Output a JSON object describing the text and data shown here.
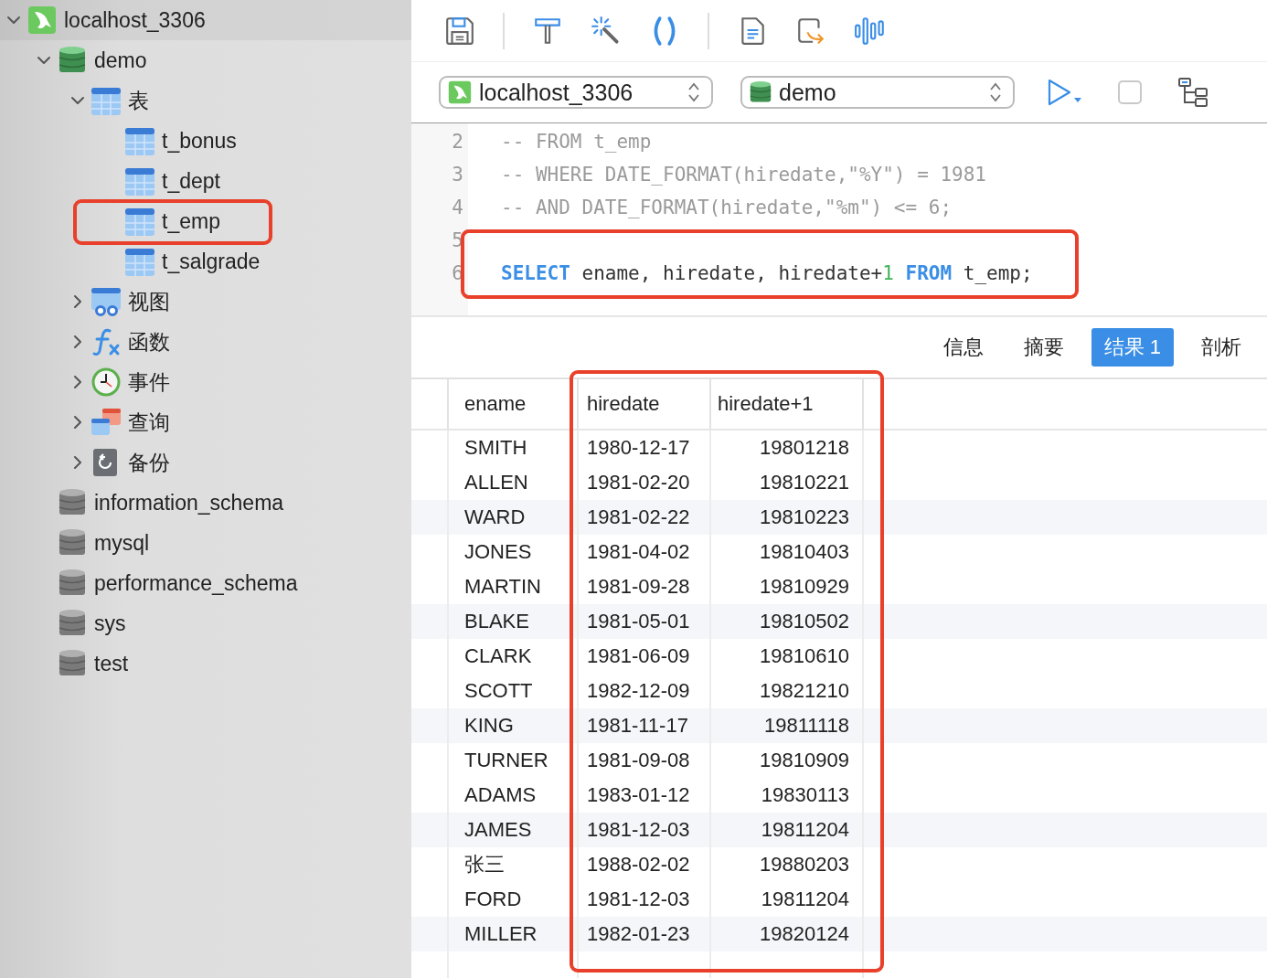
{
  "tree": [
    {
      "label": "localhost_3306",
      "kind": "server",
      "expanded": true,
      "children": [
        {
          "label": "demo",
          "kind": "db-open",
          "expanded": true,
          "children": [
            {
              "label": "表",
              "kind": "tables",
              "expanded": true,
              "children": [
                {
                  "label": "t_bonus",
                  "kind": "table",
                  "highlighted": false
                },
                {
                  "label": "t_dept",
                  "kind": "table",
                  "highlighted": false
                },
                {
                  "label": "t_emp",
                  "kind": "table",
                  "highlighted": true
                },
                {
                  "label": "t_salgrade",
                  "kind": "table",
                  "highlighted": false
                }
              ]
            },
            {
              "label": "视图",
              "kind": "views",
              "expanded": false
            },
            {
              "label": "函数",
              "kind": "functions",
              "expanded": false
            },
            {
              "label": "事件",
              "kind": "events",
              "expanded": false
            },
            {
              "label": "查询",
              "kind": "queries",
              "expanded": false
            },
            {
              "label": "备份",
              "kind": "backups",
              "expanded": false
            }
          ]
        },
        {
          "label": "information_schema",
          "kind": "db"
        },
        {
          "label": "mysql",
          "kind": "db"
        },
        {
          "label": "performance_schema",
          "kind": "db"
        },
        {
          "label": "sys",
          "kind": "db"
        },
        {
          "label": "test",
          "kind": "db"
        }
      ]
    }
  ],
  "connection_select": {
    "value": "localhost_3306"
  },
  "database_select": {
    "value": "demo"
  },
  "editor_lines": [
    {
      "number": "2",
      "highlighted": false,
      "tokens": [
        {
          "text": "-- FROM t_emp",
          "kind": "comment"
        }
      ]
    },
    {
      "number": "3",
      "highlighted": false,
      "tokens": [
        {
          "text": "-- WHERE DATE_FORMAT(hiredate,\"%Y\") = 1981",
          "kind": "comment"
        }
      ]
    },
    {
      "number": "4",
      "highlighted": false,
      "tokens": [
        {
          "text": "-- AND DATE_FORMAT(hiredate,\"%m\") <= 6;",
          "kind": "comment"
        }
      ]
    },
    {
      "number": "5",
      "highlighted": true
    },
    {
      "number": "6",
      "highlighted": true,
      "tokens": [
        {
          "text": "SELECT",
          "kind": "keyword"
        },
        {
          "text": " ename, hiredate, hiredate+",
          "kind": "plain"
        },
        {
          "text": "1",
          "kind": "number"
        },
        {
          "text": " FROM",
          "kind": "keyword"
        },
        {
          "text": " t_emp;",
          "kind": "plain"
        }
      ]
    }
  ],
  "result_tabs": [
    {
      "label": "信息",
      "selected": false
    },
    {
      "label": "摘要",
      "selected": false
    },
    {
      "label": "结果 1",
      "selected": true
    },
    {
      "label": "剖析",
      "selected": false
    }
  ],
  "table": {
    "columns": [
      {
        "label": "ename",
        "highlighted": false
      },
      {
        "label": "hiredate",
        "highlighted": true
      },
      {
        "label": "hiredate+1",
        "highlighted": true
      }
    ],
    "rows": [
      [
        "SMITH",
        "1980-12-17",
        "19801218"
      ],
      [
        "ALLEN",
        "1981-02-20",
        "19810221"
      ],
      [
        "WARD",
        "1981-02-22",
        "19810223"
      ],
      [
        "JONES",
        "1981-04-02",
        "19810403"
      ],
      [
        "MARTIN",
        "1981-09-28",
        "19810929"
      ],
      [
        "BLAKE",
        "1981-05-01",
        "19810502"
      ],
      [
        "CLARK",
        "1981-06-09",
        "19810610"
      ],
      [
        "SCOTT",
        "1982-12-09",
        "19821210"
      ],
      [
        "KING",
        "1981-11-17",
        "19811118"
      ],
      [
        "TURNER",
        "1981-09-08",
        "19810909"
      ],
      [
        "ADAMS",
        "1983-01-12",
        "19830113"
      ],
      [
        "JAMES",
        "1981-12-03",
        "19811204"
      ],
      [
        "张三",
        "1988-02-02",
        "19880203"
      ],
      [
        "FORD",
        "1981-12-03",
        "19811204"
      ],
      [
        "MILLER",
        "1982-01-23",
        "19820124"
      ]
    ]
  }
}
